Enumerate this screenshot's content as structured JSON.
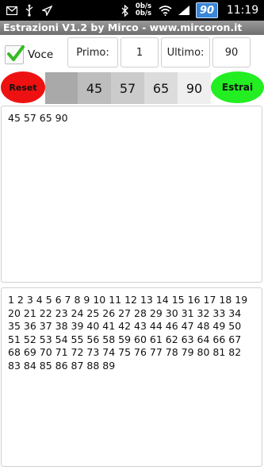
{
  "status_bar": {
    "battery": "90",
    "net_up": "0b/s",
    "net_down": "0b/s",
    "time": "11:19"
  },
  "app": {
    "title": "Estrazioni V1.2 by Mirco - www.mircoron.it"
  },
  "controls": {
    "voce_label": "Voce",
    "voce_checked": true,
    "primo_label": "Primo:",
    "primo_value": "1",
    "ultimo_label": "Ultimo:",
    "ultimo_value": "90"
  },
  "actions": {
    "reset_label": "Reset",
    "estrai_label": "Estrai"
  },
  "strip": {
    "cells": [
      "",
      "45",
      "57",
      "65",
      "90"
    ]
  },
  "drawn": {
    "text": "45 57 65 90"
  },
  "remaining": {
    "text": "1 2 3 4 5 6 7 8 9 10 11 12 13 14 15 16 17 18 19 20 21 22 23 24 25 26 27 28 29 30 31 32 33 34 35 36 37 38 39 40 41 42 43 44 46 47 48 49 50 51 52 53 54 55 56 58 59 60 61 62 63 64 66 67 68 69 70 71 72 73 74 75 76 77 78 79 80 81 82 83 84 85 86 87 88 89"
  },
  "colors": {
    "reset_button": "#ee1111",
    "estrai_button": "#22ee22",
    "check": "#33bb22"
  }
}
